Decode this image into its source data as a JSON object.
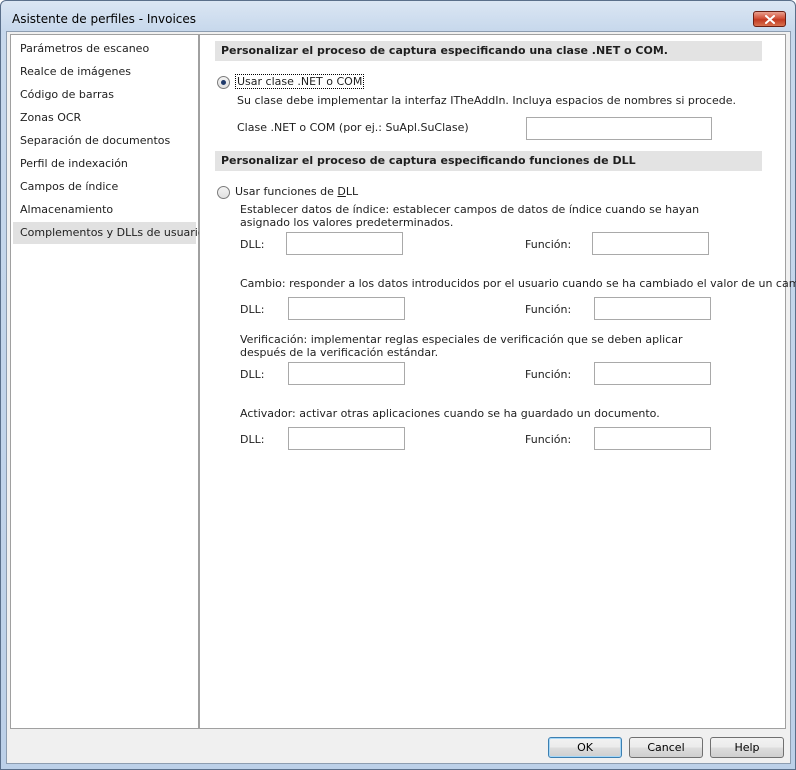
{
  "window": {
    "title": "Asistente de perfiles - Invoices"
  },
  "sidebar": {
    "items": [
      {
        "label": "Parámetros de escaneo"
      },
      {
        "label": "Realce de imágenes"
      },
      {
        "label": "Código de barras"
      },
      {
        "label": "Zonas OCR"
      },
      {
        "label": "Separación de documentos"
      },
      {
        "label": "Perfil de indexación"
      },
      {
        "label": "Campos de índice"
      },
      {
        "label": "Almacenamiento"
      },
      {
        "label": "Complementos y DLLs de usuario"
      }
    ],
    "selected": "Complementos y DLLs de usuario"
  },
  "section_net": {
    "header": "Personalizar el proceso de captura especificando una clase .NET o COM.",
    "radio_label": "Usar clase .NET o COM",
    "selected": true,
    "description": "Su clase debe implementar la interfaz ITheAddIn. Incluya espacios de nombres si procede.",
    "class_label": "Clase .NET o COM  (por ej.: SuApl.SuClase)",
    "class_value": ""
  },
  "section_dll": {
    "header": "Personalizar el proceso de captura especificando funciones de DLL",
    "radio_prefix": "Usar funciones de ",
    "radio_hotkey": "D",
    "radio_suffix": "LL",
    "selected": false,
    "dll_label": "DLL:",
    "function_label": "Función:",
    "groups": [
      {
        "description": "Establecer datos de índice: establecer campos de datos de índice cuando se hayan asignado los valores predeterminados.",
        "dll_value": "",
        "function_value": ""
      },
      {
        "description": "Cambio: responder a los datos introducidos por el usuario cuando se ha cambiado el valor de un campo.",
        "dll_value": "",
        "function_value": ""
      },
      {
        "description": "Verificación: implementar reglas especiales de verificación que se deben aplicar después de la verificación estándar.",
        "dll_value": "",
        "function_value": ""
      },
      {
        "description": "Activador: activar otras aplicaciones cuando se ha guardado un documento.",
        "dll_value": "",
        "function_value": ""
      }
    ]
  },
  "buttons": {
    "ok": "OK",
    "cancel": "Cancel",
    "help": "Help"
  },
  "colors": {
    "close_button": "#c23a22",
    "titlebar": "#c7d8ec",
    "section_header": "#e3e3e3",
    "selected_item": "#e1e1e1"
  },
  "icons": {
    "close": "close-icon"
  }
}
